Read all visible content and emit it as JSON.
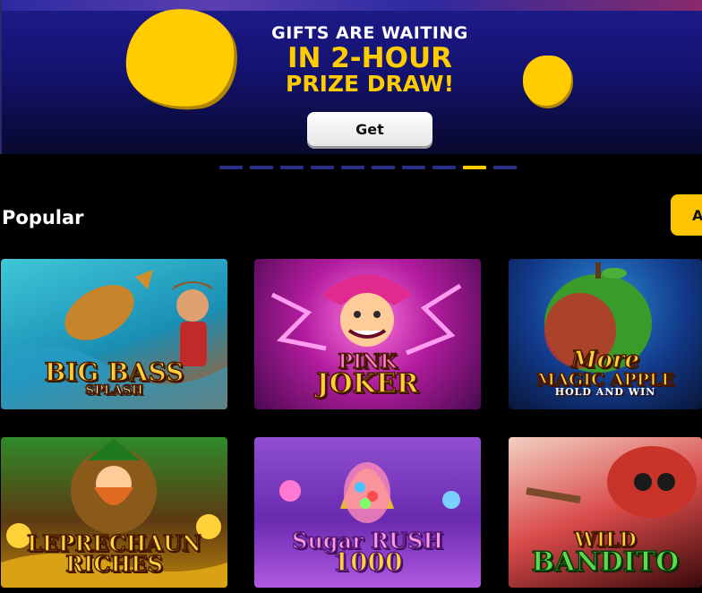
{
  "banner": {
    "line1": "GIFTS ARE WAITING",
    "line2": "IN 2-HOUR",
    "line3": "PRIZE DRAW!",
    "cta": "Get",
    "slide_count": 10,
    "active_slide": 9
  },
  "section": {
    "title": "Popular",
    "all_button": "A"
  },
  "games": [
    {
      "title_line1": "BIG BASS",
      "title_line2": "SPLASH"
    },
    {
      "title_line1": "PINK",
      "title_line2": "JOKER"
    },
    {
      "title_line1": "More",
      "title_line2": "MAGIC APPLE",
      "title_line3": "HOLD AND WIN"
    },
    {
      "title_line1": "LEPRECHAUN",
      "title_line2": "RICHES"
    },
    {
      "title_line1": "Sugar RUSH",
      "title_line2": "1000"
    },
    {
      "title_line1": "WILD",
      "title_line2": "BANDITO"
    }
  ],
  "colors": {
    "accent": "#ffcc00",
    "banner_bg": "#1d1b8c",
    "page_bg": "#000000"
  }
}
